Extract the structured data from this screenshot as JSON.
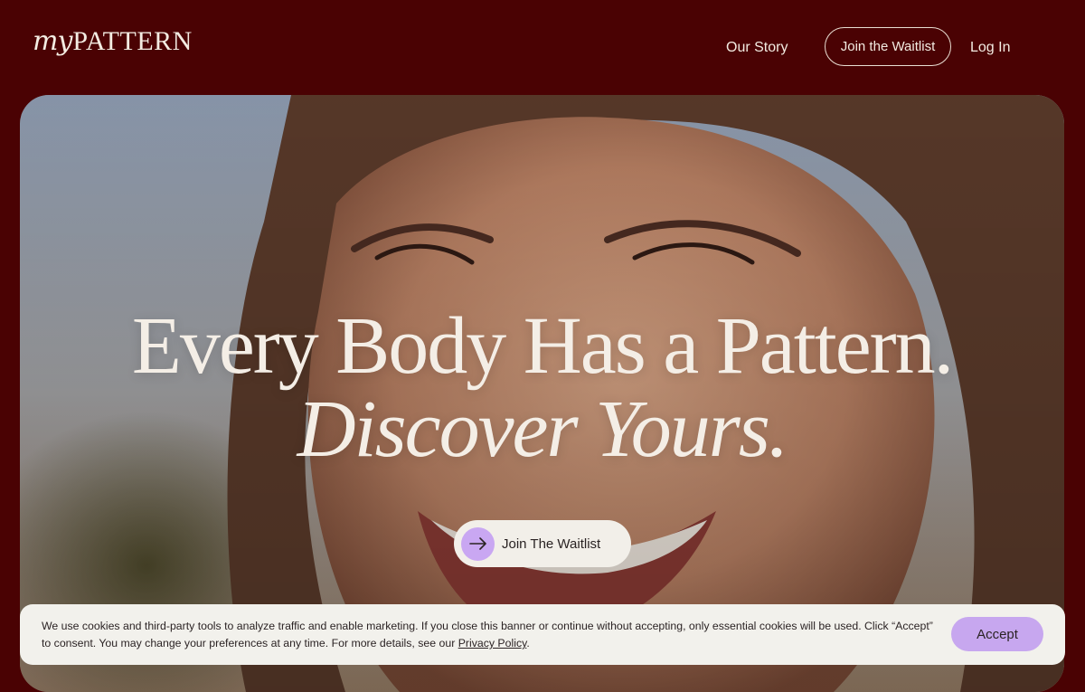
{
  "header": {
    "logo_script": "my",
    "logo_word": "PATTERN",
    "nav": {
      "our_story": "Our Story",
      "join_waitlist": "Join the Waitlist",
      "log_in": "Log In"
    }
  },
  "hero": {
    "headline_line1": "Every Body Has a Pattern.",
    "headline_line2": "Discover Yours.",
    "cta_label": "Join The Waitlist",
    "cta_icon": "arrow-right-icon"
  },
  "cookie_banner": {
    "text_before_link": "We use cookies and third-party tools to analyze traffic and enable marketing. If you close this banner or continue without accepting, only essential cookies will be used. Click “Accept” to consent. You may change your preferences at any time. For more details, see our ",
    "link_text": "Privacy Policy",
    "text_after_link": ".",
    "accept_label": "Accept"
  },
  "colors": {
    "page_background": "#4a0203",
    "cream_text": "#f3ece2",
    "accent_lavender": "#c9a7f2",
    "banner_background": "#f2f1ec"
  }
}
